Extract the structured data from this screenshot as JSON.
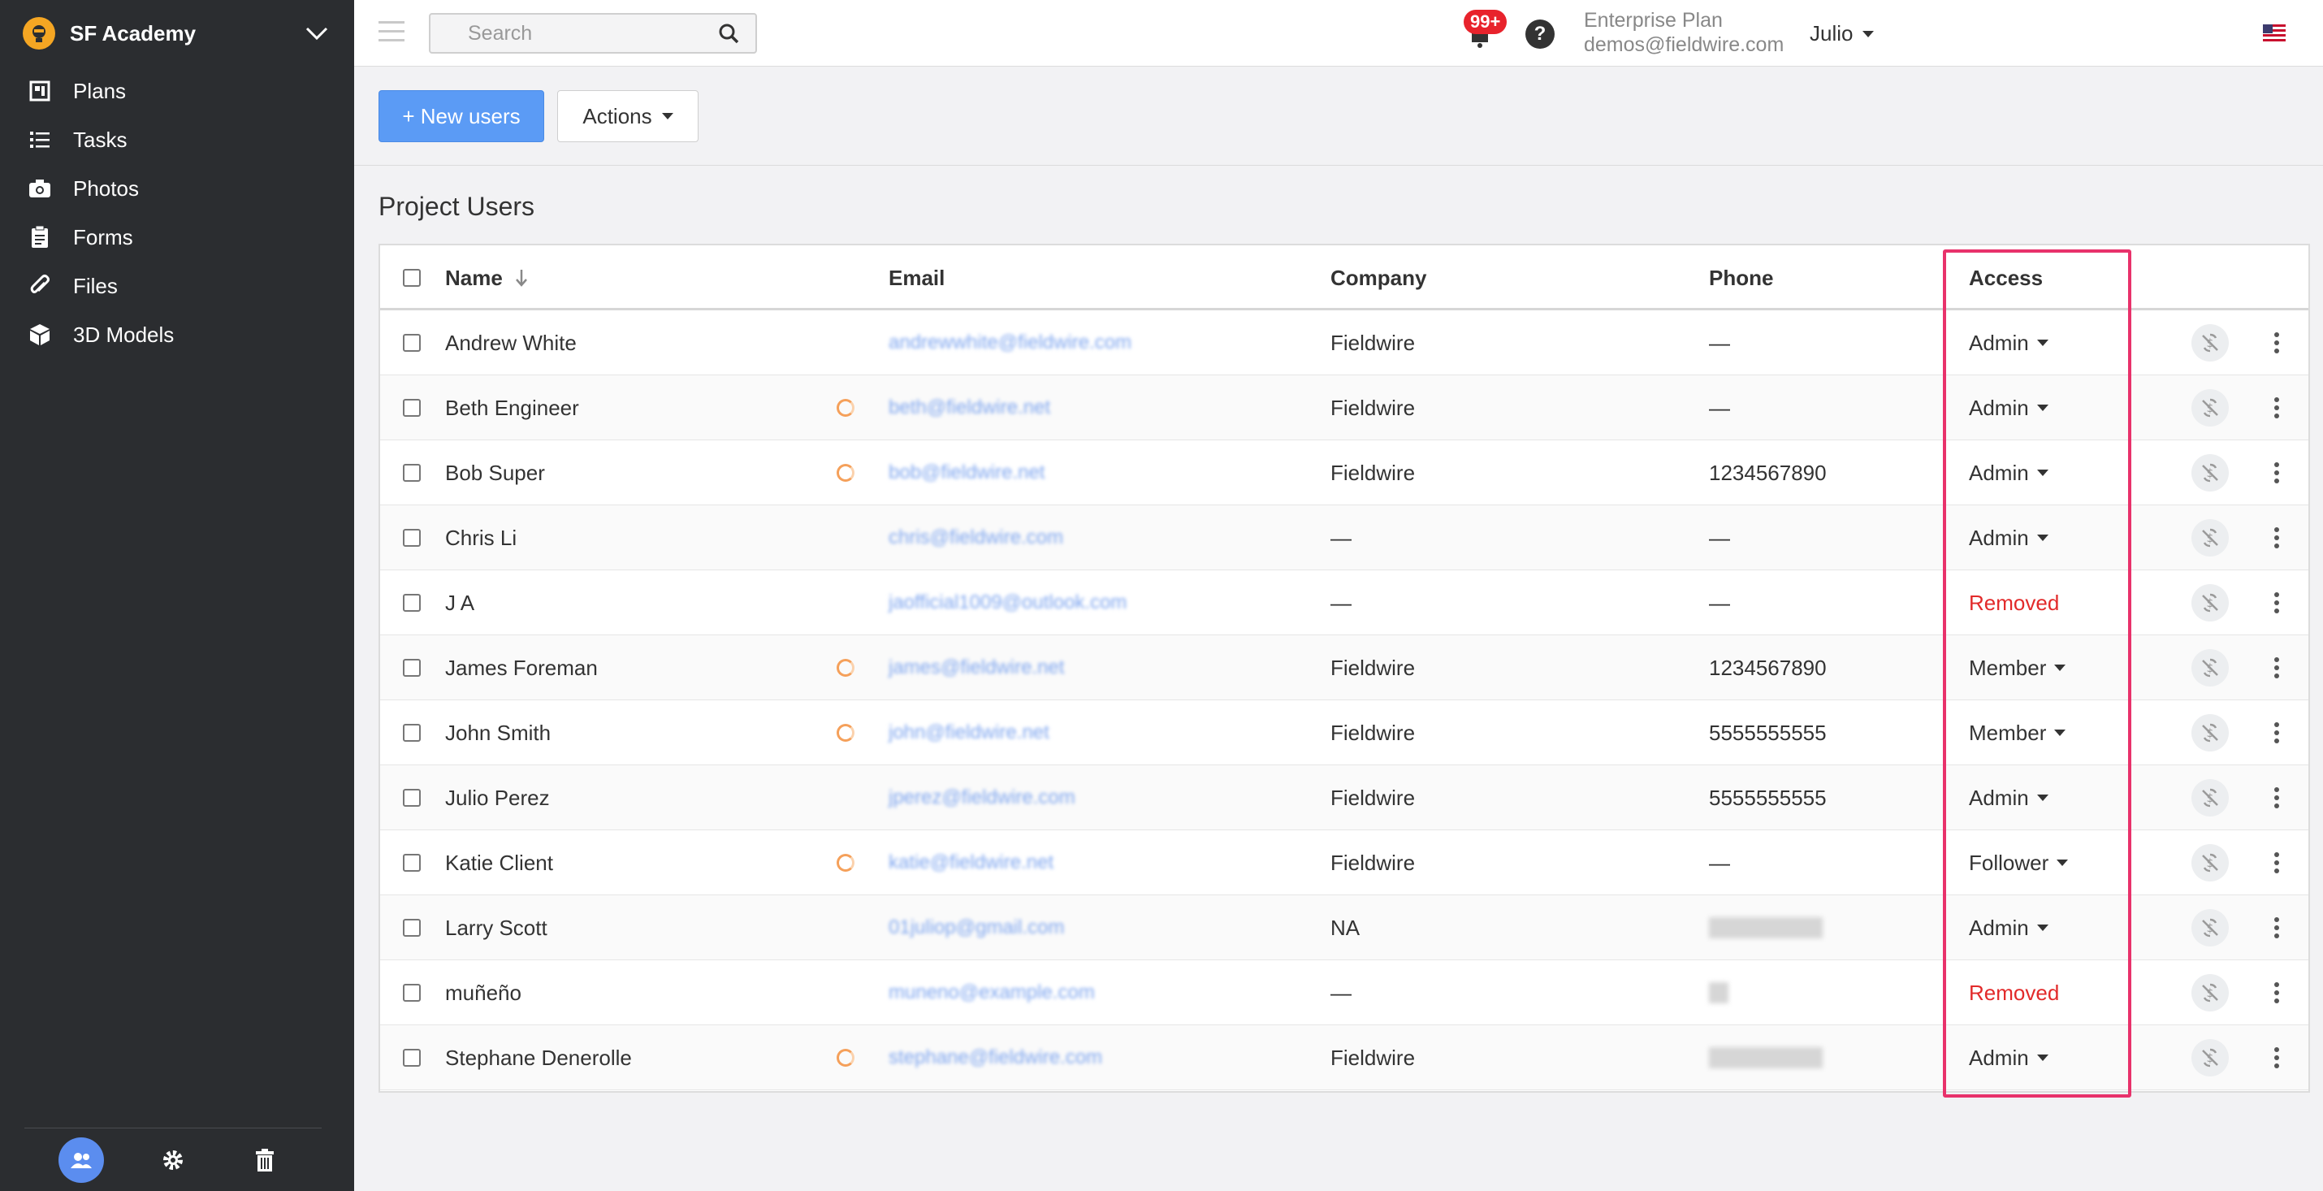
{
  "project": {
    "name": "SF Academy"
  },
  "sidebar": {
    "items": [
      {
        "label": "Plans",
        "icon": "plans-icon"
      },
      {
        "label": "Tasks",
        "icon": "tasks-icon"
      },
      {
        "label": "Photos",
        "icon": "camera-icon"
      },
      {
        "label": "Forms",
        "icon": "clipboard-icon"
      },
      {
        "label": "Files",
        "icon": "paperclip-icon"
      },
      {
        "label": "3D Models",
        "icon": "cube-icon"
      }
    ]
  },
  "topbar": {
    "search_placeholder": "Search",
    "notification_count": "99+",
    "help": "?",
    "plan_name": "Enterprise Plan",
    "account_email": "demos@fieldwire.com",
    "user_name": "Julio"
  },
  "toolbar": {
    "new_users_label": "+ New users",
    "actions_label": "Actions"
  },
  "section_title": "Project Users",
  "table": {
    "headers": {
      "name": "Name",
      "email": "Email",
      "company": "Company",
      "phone": "Phone",
      "access": "Access"
    },
    "rows": [
      {
        "name": "Andrew White",
        "email": "andrewwhite@fieldwire.com",
        "company": "Fieldwire",
        "phone": "—",
        "access": "Admin",
        "sync": false,
        "phone_blur": ""
      },
      {
        "name": "Beth Engineer",
        "email": "beth@fieldwire.net",
        "company": "Fieldwire",
        "phone": "—",
        "access": "Admin",
        "sync": true,
        "phone_blur": ""
      },
      {
        "name": "Bob Super",
        "email": "bob@fieldwire.net",
        "company": "Fieldwire",
        "phone": "1234567890",
        "access": "Admin",
        "sync": true,
        "phone_blur": ""
      },
      {
        "name": "Chris Li",
        "email": "chris@fieldwire.com",
        "company": "—",
        "phone": "—",
        "access": "Admin",
        "sync": false,
        "phone_blur": ""
      },
      {
        "name": "J A",
        "email": "jaofficial1009@outlook.com",
        "company": "—",
        "phone": "—",
        "access": "Removed",
        "sync": false,
        "phone_blur": ""
      },
      {
        "name": "James Foreman",
        "email": "james@fieldwire.net",
        "company": "Fieldwire",
        "phone": "1234567890",
        "access": "Member",
        "sync": true,
        "phone_blur": ""
      },
      {
        "name": "John Smith",
        "email": "john@fieldwire.net",
        "company": "Fieldwire",
        "phone": "5555555555",
        "access": "Member",
        "sync": true,
        "phone_blur": ""
      },
      {
        "name": "Julio Perez",
        "email": "jperez@fieldwire.com",
        "company": "Fieldwire",
        "phone": "5555555555",
        "access": "Admin",
        "sync": false,
        "phone_blur": ""
      },
      {
        "name": "Katie Client",
        "email": "katie@fieldwire.net",
        "company": "Fieldwire",
        "phone": "—",
        "access": "Follower",
        "sync": true,
        "phone_blur": ""
      },
      {
        "name": "Larry Scott",
        "email": "01juliop@gmail.com",
        "company": "NA",
        "phone": "",
        "access": "Admin",
        "sync": false,
        "phone_blur": "wide"
      },
      {
        "name": "muñeño",
        "email": "muneno@example.com",
        "company": "—",
        "phone": "",
        "access": "Removed",
        "sync": false,
        "phone_blur": "small"
      },
      {
        "name": "Stephane Denerolle",
        "email": "stephane@fieldwire.com",
        "company": "Fieldwire",
        "phone": "",
        "access": "Admin",
        "sync": true,
        "phone_blur": "wide"
      }
    ]
  },
  "colors": {
    "primary": "#5b9bf5",
    "removed": "#e22a2a",
    "highlight": "#e8326b",
    "sidebar_bg": "#2b2d30"
  }
}
